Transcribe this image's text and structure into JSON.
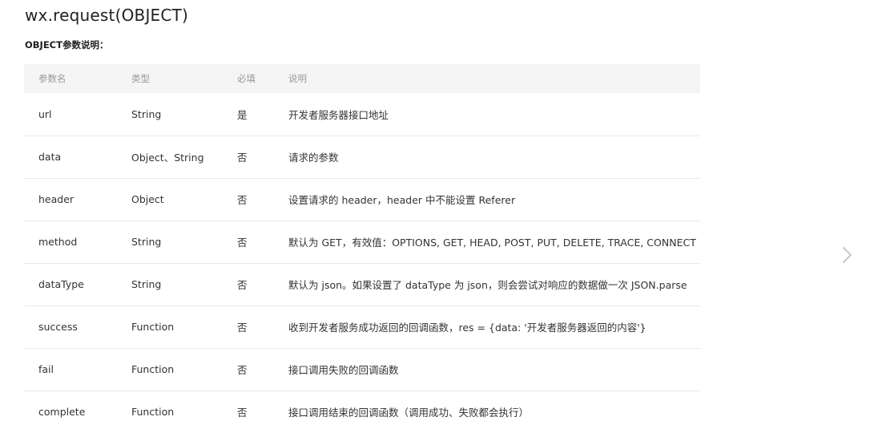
{
  "page": {
    "title": "wx.request(OBJECT)",
    "subtitle": "OBJECT参数说明："
  },
  "table": {
    "headers": {
      "name": "参数名",
      "type": "类型",
      "required": "必填",
      "desc": "说明"
    },
    "rows": [
      {
        "name": "url",
        "type": "String",
        "required": "是",
        "desc": "开发者服务器接口地址"
      },
      {
        "name": "data",
        "type": "Object、String",
        "required": "否",
        "desc": "请求的参数"
      },
      {
        "name": "header",
        "type": "Object",
        "required": "否",
        "desc": "设置请求的 header，header 中不能设置 Referer"
      },
      {
        "name": "method",
        "type": "String",
        "required": "否",
        "desc": "默认为 GET，有效值：OPTIONS, GET, HEAD, POST, PUT, DELETE, TRACE, CONNECT"
      },
      {
        "name": "dataType",
        "type": "String",
        "required": "否",
        "desc": "默认为 json。如果设置了 dataType 为 json，则会尝试对响应的数据做一次 JSON.parse"
      },
      {
        "name": "success",
        "type": "Function",
        "required": "否",
        "desc": "收到开发者服务成功返回的回调函数，res = {data: '开发者服务器返回的内容'}"
      },
      {
        "name": "fail",
        "type": "Function",
        "required": "否",
        "desc": "接口调用失败的回调函数"
      },
      {
        "name": "complete",
        "type": "Function",
        "required": "否",
        "desc": "接口调用结束的回调函数（调用成功、失败都会执行）"
      }
    ]
  },
  "nav": {
    "next_icon": "chevron-right-icon",
    "next_color": "#c8c8c8"
  }
}
